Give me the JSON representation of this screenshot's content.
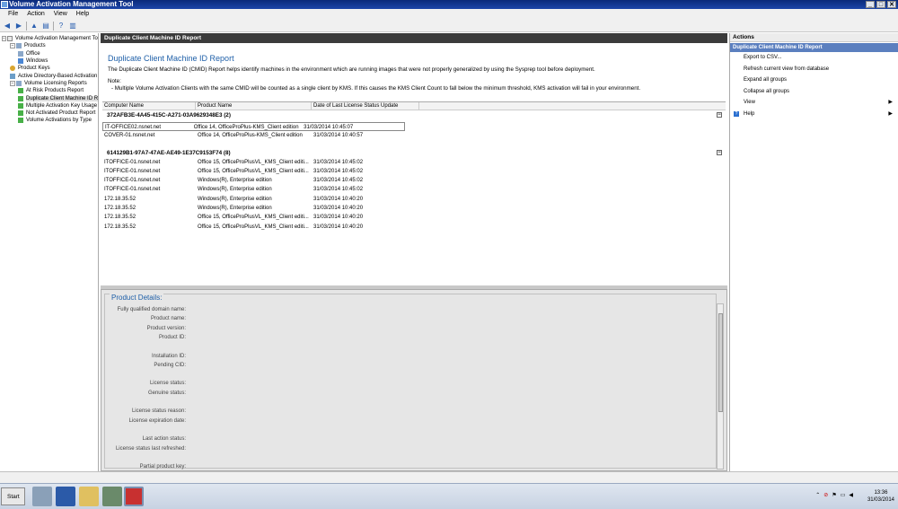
{
  "window": {
    "title": "Volume Activation Management Tool"
  },
  "menu": [
    "File",
    "Action",
    "View",
    "Help"
  ],
  "tree": [
    {
      "label": "Volume Activation Management Tool",
      "level": 0,
      "icon": "tree0",
      "exp": "-"
    },
    {
      "label": "Products",
      "level": 1,
      "icon": "folder",
      "exp": "-"
    },
    {
      "label": "Office",
      "level": 2,
      "icon": "folder",
      "exp": ""
    },
    {
      "label": "Windows",
      "level": 2,
      "icon": "win",
      "exp": ""
    },
    {
      "label": "Product Keys",
      "level": 1,
      "icon": "key",
      "exp": ""
    },
    {
      "label": "Active Directory-Based Activation",
      "level": 1,
      "icon": "ad",
      "exp": ""
    },
    {
      "label": "Volume Licensing Reports",
      "level": 1,
      "icon": "folder",
      "exp": "-"
    },
    {
      "label": "At Risk Products Report",
      "level": 2,
      "icon": "rep",
      "exp": ""
    },
    {
      "label": "Duplicate Client Machine ID Re",
      "level": 2,
      "icon": "rep",
      "exp": "",
      "selected": true
    },
    {
      "label": "Multiple Activation Key Usage",
      "level": 2,
      "icon": "rep",
      "exp": ""
    },
    {
      "label": "Not Activated Product Report",
      "level": 2,
      "icon": "rep",
      "exp": ""
    },
    {
      "label": "Volume Activations by Type",
      "level": 2,
      "icon": "rep",
      "exp": ""
    }
  ],
  "center": {
    "header": "Duplicate Client Machine ID Report",
    "report_title": "Duplicate Client Machine ID Report",
    "description": "The Duplicate Client Machine ID (CMID) Report helps identify machines in the environment which are running images that were not properly generalized by using the Sysprep tool before deployment.",
    "note_label": "Note:",
    "note_text": "- Multiple Volume Activation Clients with the same CMID will be counted as a single client by KMS. If this causes the KMS Client Count to fall below the minimum threshold, KMS activation will fail in your environment."
  },
  "grid": {
    "columns": [
      "Computer Name",
      "Product Name",
      "Date of Last License Status Update"
    ],
    "groups": [
      {
        "name": "372AFB3E-4A45-415C-A271-03A9629348E3 (2)",
        "rows": [
          [
            "IT-OFFICE02.nsnet.net",
            "Office 14, OfficeProPlus-KMS_Client edition",
            "31/03/2014 10:45:07"
          ],
          [
            "COVER-01.nsnet.net",
            "Office 14, OfficeProPlus-KMS_Client edition",
            "31/03/2014 10:40:57"
          ]
        ]
      },
      {
        "name": "614129B1-97A7-47AE-AE49-1E37C9153F74 (8)",
        "rows": [
          [
            "ITOFFICE-01.nsnet.net",
            "Office 15, OfficeProPlusVL_KMS_Client editi...",
            "31/03/2014 10:45:02"
          ],
          [
            "ITOFFICE-01.nsnet.net",
            "Office 15, OfficeProPlusVL_KMS_Client editi...",
            "31/03/2014 10:45:02"
          ],
          [
            "ITOFFICE-01.nsnet.net",
            "Windows(R), Enterprise edition",
            "31/03/2014 10:45:02"
          ],
          [
            "ITOFFICE-01.nsnet.net",
            "Windows(R), Enterprise edition",
            "31/03/2014 10:45:02"
          ],
          [
            "172.18.35.52",
            "Windows(R), Enterprise edition",
            "31/03/2014 10:40:20"
          ],
          [
            "172.18.35.52",
            "Windows(R), Enterprise edition",
            "31/03/2014 10:40:20"
          ],
          [
            "172.18.35.52",
            "Office 15, OfficeProPlusVL_KMS_Client editi...",
            "31/03/2014 10:40:20"
          ],
          [
            "172.18.35.52",
            "Office 15, OfficeProPlusVL_KMS_Client editi...",
            "31/03/2014 10:40:20"
          ]
        ]
      }
    ]
  },
  "details": {
    "title": "Product Details:",
    "fields": [
      "Fully qualified domain name:",
      "Product name:",
      "Product version:",
      "Product ID:",
      "",
      "Installation ID:",
      "Pending CID:",
      "",
      "License status:",
      "Genuine status:",
      "",
      "License status reason:",
      "License expiration date:",
      "",
      "Last action status:",
      "License status last refreshed:",
      "",
      "Partial product key:"
    ]
  },
  "actions": {
    "header": "Actions",
    "subheader": "Duplicate Client Machine ID Report",
    "items": [
      {
        "label": "Export to CSV...",
        "submenu": false
      },
      {
        "label": "Refresh current view from database",
        "submenu": false
      },
      {
        "label": "Expand all groups",
        "submenu": false
      },
      {
        "label": "Collapse all groups",
        "submenu": false
      },
      {
        "label": "View",
        "submenu": true
      },
      {
        "label": "Help",
        "submenu": false,
        "icon": "help-icon"
      }
    ]
  },
  "taskbar": {
    "start_label": "Start",
    "clock_time": "13:36",
    "clock_date": "31/03/2014"
  }
}
